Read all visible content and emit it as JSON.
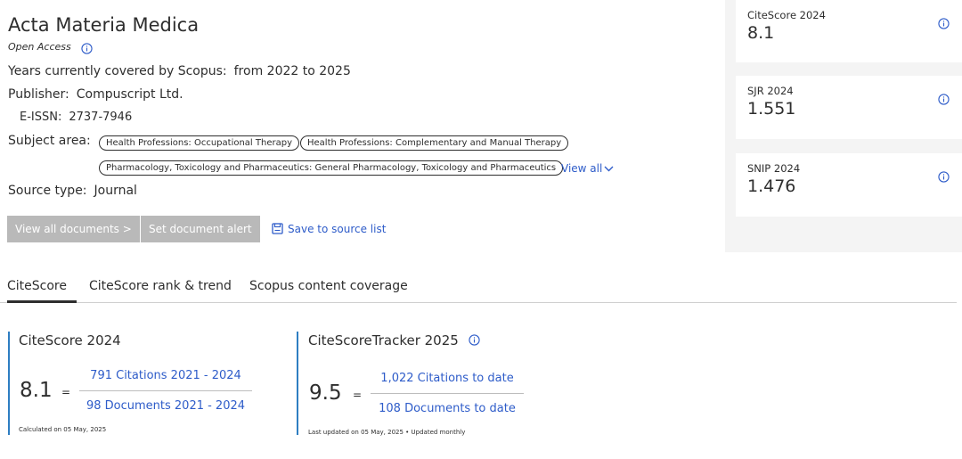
{
  "source": {
    "title": "Acta Materia Medica",
    "open_access": "Open Access",
    "years_label": "Years currently covered by Scopus:",
    "years_value": "from 2022 to 2025",
    "publisher_label": "Publisher:",
    "publisher_value": "Compuscript Ltd.",
    "eissn_label": "E-ISSN:",
    "eissn_value": "2737-7946",
    "subject_label": "Subject area:",
    "subjects": [
      "Health Professions: Occupational Therapy",
      "Health Professions: Complementary and Manual Therapy",
      "Pharmacology, Toxicology and Pharmaceutics: General Pharmacology, Toxicology and Pharmaceutics"
    ],
    "view_all": "View all",
    "source_type_label": "Source type:",
    "source_type_value": "Journal"
  },
  "actions": {
    "view_all_documents": "View all documents >",
    "set_alert": "Set document alert",
    "save_to_list": "Save to source list"
  },
  "metrics": [
    {
      "label": "CiteScore 2024",
      "value": "8.1"
    },
    {
      "label": "SJR 2024",
      "value": "1.551"
    },
    {
      "label": "SNIP 2024",
      "value": "1.476"
    }
  ],
  "tabs": [
    {
      "label": "CiteScore",
      "active": true
    },
    {
      "label": "CiteScore rank & trend",
      "active": false
    },
    {
      "label": "Scopus content coverage",
      "active": false
    }
  ],
  "citescore": {
    "title": "CiteScore 2024",
    "value": "8.1",
    "equals": "=",
    "citations": "791 Citations 2021 - 2024",
    "documents": "98 Documents 2021 - 2024",
    "note": "Calculated on 05 May, 2025"
  },
  "tracker": {
    "title": "CiteScoreTracker 2025",
    "value": "9.5",
    "equals": "=",
    "citations": "1,022 Citations to date",
    "documents": "108 Documents to date",
    "note": "Last updated on 05 May, 2025 • Updated monthly"
  },
  "colors": {
    "link": "#2e5cc9",
    "accent_border": "#2e7ec2",
    "button_disabled": "#b9b9b9",
    "panel_gray": "#f4f4f4"
  },
  "icons": [
    "info-icon",
    "chevron-down-icon",
    "save-list-icon"
  ]
}
